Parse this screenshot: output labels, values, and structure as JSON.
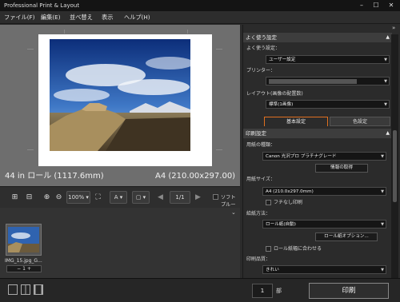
{
  "window": {
    "title": "Professional Print & Layout"
  },
  "menu": {
    "items": [
      "ファイル(F)",
      "編集(E)",
      "並べ替え",
      "表示",
      "ヘルプ(H)"
    ]
  },
  "preview": {
    "roll_size": "44 in ロール (1117.6mm)",
    "page_size": "A4 (210.00x297.00)"
  },
  "toolbar": {
    "zoom": "100%",
    "page": "1/1",
    "softproof_label": "ソフトプルーフ"
  },
  "thumbnail": {
    "filename": "IMG_15.jpg_G...",
    "copies": "1"
  },
  "bottom": {
    "copies": "1",
    "copies_unit": "部",
    "print_label": "印刷"
  },
  "right_panel": {
    "favorites_header": "よく使う設定",
    "favorites_label": "よく使う設定：",
    "favorites_value": "ユーザー設定",
    "printer_label": "プリンター：",
    "layout_label": "レイアウト(画像の配置数)",
    "layout_value": "標準(1画像)",
    "tab_basic": "基本設定",
    "tab_color": "色設定",
    "print_settings_header": "印刷設定",
    "media_type_label": "用紙の種類：",
    "media_type_value": "Canon 光沢プロ プラチナグレード",
    "get_info_button": "情報の取得",
    "paper_size_label": "用紙サイズ：",
    "paper_size_value": "A4 (210.0x297.0mm)",
    "borderless_label": "フチなし印刷",
    "feed_method_label": "給紙方法：",
    "feed_method_value": "ロール紙(自動)",
    "roll_options_button": "ロール紙オプション...",
    "fit_roll_label": "ロール紙幅に合わせる",
    "print_quality_label": "印刷品質：",
    "print_quality_value": "きれい"
  },
  "colors": {
    "accent": "#e07020",
    "panel": "#2b2b2b",
    "preview_bg": "#6e6e6e"
  }
}
